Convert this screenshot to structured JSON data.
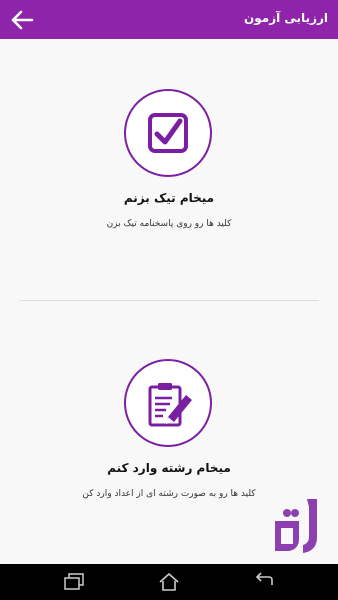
{
  "header": {
    "title": "ارزیابی آزمون"
  },
  "options": [
    {
      "icon": "checkbox-checked-icon",
      "title": "میخام تیک بزنم",
      "subtitle": "کلید ها رو روی پاسخنامه تیک بزن"
    },
    {
      "icon": "edit-document-icon",
      "title": "میخام رشته وارد کنم",
      "subtitle": "کلید ها رو به صورت رشته ای از اعداد وارد کن"
    }
  ],
  "navbar": {
    "icons": [
      "recent-apps-icon",
      "home-icon",
      "back-nav-icon"
    ]
  },
  "colors": {
    "accent": "#8e24aa",
    "icon": "#7b1fa2",
    "background": "#f8f8f8",
    "navbar": "#000000"
  }
}
